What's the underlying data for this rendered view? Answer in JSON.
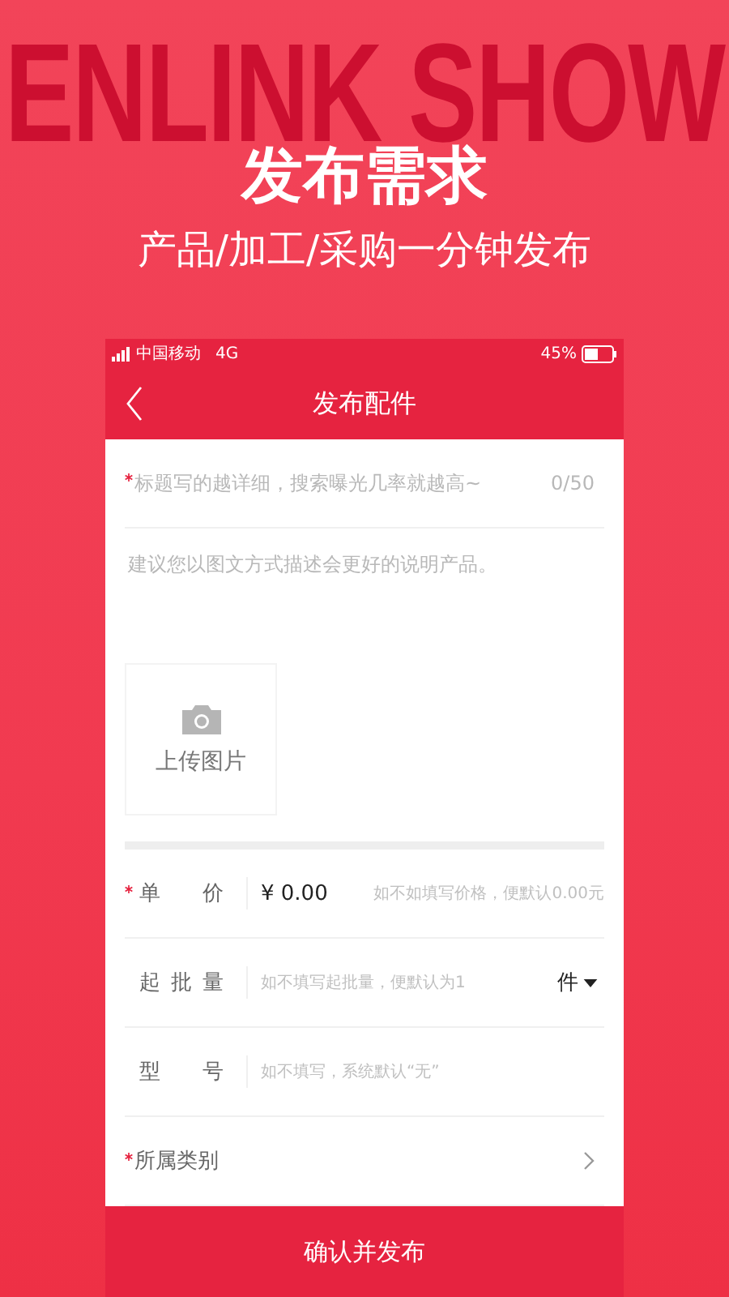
{
  "banner": {
    "watermark": "ENLINK SHOW",
    "title": "发布需求",
    "subtitle": "产品/加工/采购一分钟发布"
  },
  "status_bar": {
    "carrier": "中国移动",
    "network": "4G",
    "battery": "45%"
  },
  "nav": {
    "title": "发布配件"
  },
  "title_field": {
    "required": true,
    "placeholder": "标题写的越详细，搜索曝光几率就越高~",
    "counter": "0/50"
  },
  "description_field": {
    "placeholder": "建议您以图文方式描述会更好的说明产品。"
  },
  "upload": {
    "label": "上传图片"
  },
  "rows": [
    {
      "kind": "input",
      "label": "单价",
      "required": true,
      "value": "¥ 0.00",
      "placeholder": "如不如填写价格，便默认0.00元"
    },
    {
      "kind": "input",
      "label": "起批量",
      "required": false,
      "placeholder": "如不填写起批量，便默认为1",
      "unit": "件"
    },
    {
      "kind": "input",
      "label": "型号",
      "required": false,
      "placeholder": "如不填写，系统默认“无”"
    },
    {
      "kind": "link",
      "label": "所属类别",
      "required": true
    }
  ],
  "submit": "确认并发布"
}
